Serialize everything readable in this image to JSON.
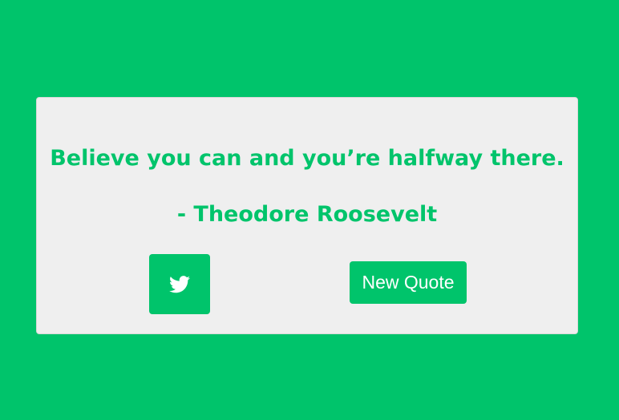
{
  "colors": {
    "background": "#00c46b",
    "card": "#efefef",
    "accent": "#00c46b",
    "button_text": "#ffffff"
  },
  "quote": {
    "text": "Believe you can and you’re halfway there.",
    "author": "- Theodore Roosevelt"
  },
  "actions": {
    "tweet_icon": "twitter-icon",
    "new_quote_label": "New Quote"
  }
}
